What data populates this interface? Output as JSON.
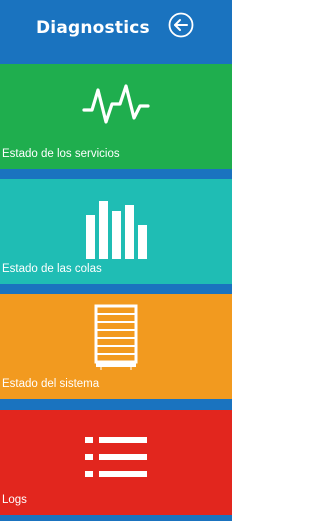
{
  "header": {
    "title": "Diagnostics",
    "back_icon": "arrow-left-circle-icon"
  },
  "tiles": [
    {
      "label": "Estado de los servicios",
      "color": "#1fae4e",
      "icon": "pulse-icon"
    },
    {
      "label": "Estado de las colas",
      "color": "#1fbdb4",
      "icon": "bar-chart-icon"
    },
    {
      "label": "Estado del sistema",
      "color": "#f29a1f",
      "icon": "server-rack-icon"
    },
    {
      "label": "Logs",
      "color": "#e2261e",
      "icon": "list-icon"
    }
  ],
  "colors": {
    "panel_background": "#1a73bf",
    "text": "#ffffff"
  }
}
